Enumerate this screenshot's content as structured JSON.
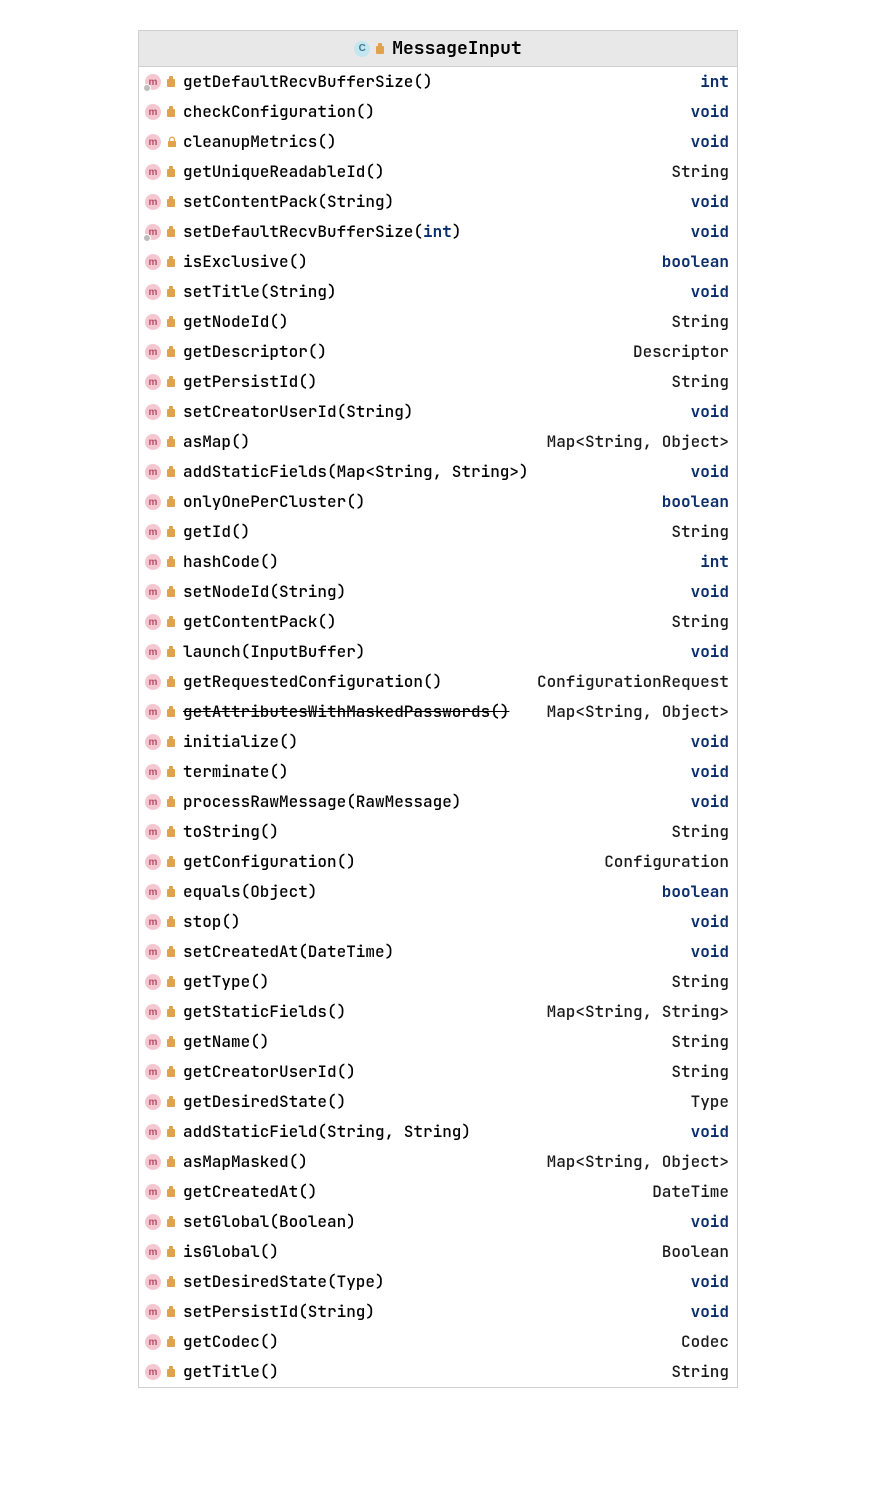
{
  "class": {
    "name": "MessageInput"
  },
  "methods": [
    {
      "abstract": true,
      "access": "public",
      "sig_parts": [
        {
          "t": "getDefaultRecvBufferSize()",
          "k": false
        }
      ],
      "ret_parts": [
        {
          "t": "int",
          "k": true
        }
      ],
      "deprecated": false
    },
    {
      "abstract": false,
      "access": "public",
      "sig_parts": [
        {
          "t": "checkConfiguration()",
          "k": false
        }
      ],
      "ret_parts": [
        {
          "t": "void",
          "k": true
        }
      ],
      "deprecated": false
    },
    {
      "abstract": false,
      "access": "private",
      "sig_parts": [
        {
          "t": "cleanupMetrics()",
          "k": false
        }
      ],
      "ret_parts": [
        {
          "t": "void",
          "k": true
        }
      ],
      "deprecated": false
    },
    {
      "abstract": false,
      "access": "public",
      "sig_parts": [
        {
          "t": "getUniqueReadableId()",
          "k": false
        }
      ],
      "ret_parts": [
        {
          "t": "String",
          "k": false
        }
      ],
      "deprecated": false
    },
    {
      "abstract": false,
      "access": "public",
      "sig_parts": [
        {
          "t": "setContentPack(String)",
          "k": false
        }
      ],
      "ret_parts": [
        {
          "t": "void",
          "k": true
        }
      ],
      "deprecated": false
    },
    {
      "abstract": true,
      "access": "public",
      "sig_parts": [
        {
          "t": "setDefaultRecvBufferSize(",
          "k": false
        },
        {
          "t": "int",
          "k": true
        },
        {
          "t": ")",
          "k": false
        }
      ],
      "ret_parts": [
        {
          "t": "void",
          "k": true
        }
      ],
      "deprecated": false
    },
    {
      "abstract": false,
      "access": "public",
      "sig_parts": [
        {
          "t": "isExclusive()",
          "k": false
        }
      ],
      "ret_parts": [
        {
          "t": "boolean",
          "k": true
        }
      ],
      "deprecated": false
    },
    {
      "abstract": false,
      "access": "public",
      "sig_parts": [
        {
          "t": "setTitle(String)",
          "k": false
        }
      ],
      "ret_parts": [
        {
          "t": "void",
          "k": true
        }
      ],
      "deprecated": false
    },
    {
      "abstract": false,
      "access": "public",
      "sig_parts": [
        {
          "t": "getNodeId()",
          "k": false
        }
      ],
      "ret_parts": [
        {
          "t": "String",
          "k": false
        }
      ],
      "deprecated": false
    },
    {
      "abstract": false,
      "access": "public",
      "sig_parts": [
        {
          "t": "getDescriptor()",
          "k": false
        }
      ],
      "ret_parts": [
        {
          "t": "Descriptor",
          "k": false
        }
      ],
      "deprecated": false
    },
    {
      "abstract": false,
      "access": "public",
      "sig_parts": [
        {
          "t": "getPersistId()",
          "k": false
        }
      ],
      "ret_parts": [
        {
          "t": "String",
          "k": false
        }
      ],
      "deprecated": false
    },
    {
      "abstract": false,
      "access": "public",
      "sig_parts": [
        {
          "t": "setCreatorUserId(String)",
          "k": false
        }
      ],
      "ret_parts": [
        {
          "t": "void",
          "k": true
        }
      ],
      "deprecated": false
    },
    {
      "abstract": false,
      "access": "public",
      "sig_parts": [
        {
          "t": "asMap()",
          "k": false
        }
      ],
      "ret_parts": [
        {
          "t": "Map<String, Object>",
          "k": false
        }
      ],
      "deprecated": false
    },
    {
      "abstract": false,
      "access": "public",
      "sig_parts": [
        {
          "t": "addStaticFields(Map<String, String>)",
          "k": false
        }
      ],
      "ret_parts": [
        {
          "t": "void",
          "k": true
        }
      ],
      "deprecated": false
    },
    {
      "abstract": false,
      "access": "public",
      "sig_parts": [
        {
          "t": "onlyOnePerCluster()",
          "k": false
        }
      ],
      "ret_parts": [
        {
          "t": "boolean",
          "k": true
        }
      ],
      "deprecated": false
    },
    {
      "abstract": false,
      "access": "public",
      "sig_parts": [
        {
          "t": "getId()",
          "k": false
        }
      ],
      "ret_parts": [
        {
          "t": "String",
          "k": false
        }
      ],
      "deprecated": false
    },
    {
      "abstract": false,
      "access": "public",
      "sig_parts": [
        {
          "t": "hashCode()",
          "k": false
        }
      ],
      "ret_parts": [
        {
          "t": "int",
          "k": true
        }
      ],
      "deprecated": false
    },
    {
      "abstract": false,
      "access": "public",
      "sig_parts": [
        {
          "t": "setNodeId(String)",
          "k": false
        }
      ],
      "ret_parts": [
        {
          "t": "void",
          "k": true
        }
      ],
      "deprecated": false
    },
    {
      "abstract": false,
      "access": "public",
      "sig_parts": [
        {
          "t": "getContentPack()",
          "k": false
        }
      ],
      "ret_parts": [
        {
          "t": "String",
          "k": false
        }
      ],
      "deprecated": false
    },
    {
      "abstract": false,
      "access": "public",
      "sig_parts": [
        {
          "t": "launch(InputBuffer)",
          "k": false
        }
      ],
      "ret_parts": [
        {
          "t": "void",
          "k": true
        }
      ],
      "deprecated": false
    },
    {
      "abstract": false,
      "access": "public",
      "sig_parts": [
        {
          "t": "getRequestedConfiguration()",
          "k": false
        }
      ],
      "ret_parts": [
        {
          "t": "ConfigurationRequest",
          "k": false
        }
      ],
      "deprecated": false
    },
    {
      "abstract": false,
      "access": "public",
      "sig_parts": [
        {
          "t": "getAttributesWithMaskedPasswords()",
          "k": false
        }
      ],
      "ret_parts": [
        {
          "t": "Map<String, Object>",
          "k": false
        }
      ],
      "deprecated": true
    },
    {
      "abstract": false,
      "access": "public",
      "sig_parts": [
        {
          "t": "initialize()",
          "k": false
        }
      ],
      "ret_parts": [
        {
          "t": "void",
          "k": true
        }
      ],
      "deprecated": false
    },
    {
      "abstract": false,
      "access": "public",
      "sig_parts": [
        {
          "t": "terminate()",
          "k": false
        }
      ],
      "ret_parts": [
        {
          "t": "void",
          "k": true
        }
      ],
      "deprecated": false
    },
    {
      "abstract": false,
      "access": "public",
      "sig_parts": [
        {
          "t": "processRawMessage(RawMessage)",
          "k": false
        }
      ],
      "ret_parts": [
        {
          "t": "void",
          "k": true
        }
      ],
      "deprecated": false
    },
    {
      "abstract": false,
      "access": "public",
      "sig_parts": [
        {
          "t": "toString()",
          "k": false
        }
      ],
      "ret_parts": [
        {
          "t": "String",
          "k": false
        }
      ],
      "deprecated": false
    },
    {
      "abstract": false,
      "access": "public",
      "sig_parts": [
        {
          "t": "getConfiguration()",
          "k": false
        }
      ],
      "ret_parts": [
        {
          "t": "Configuration",
          "k": false
        }
      ],
      "deprecated": false
    },
    {
      "abstract": false,
      "access": "public",
      "sig_parts": [
        {
          "t": "equals(Object)",
          "k": false
        }
      ],
      "ret_parts": [
        {
          "t": "boolean",
          "k": true
        }
      ],
      "deprecated": false
    },
    {
      "abstract": false,
      "access": "public",
      "sig_parts": [
        {
          "t": "stop()",
          "k": false
        }
      ],
      "ret_parts": [
        {
          "t": "void",
          "k": true
        }
      ],
      "deprecated": false
    },
    {
      "abstract": false,
      "access": "public",
      "sig_parts": [
        {
          "t": "setCreatedAt(DateTime)",
          "k": false
        }
      ],
      "ret_parts": [
        {
          "t": "void",
          "k": true
        }
      ],
      "deprecated": false
    },
    {
      "abstract": false,
      "access": "public",
      "sig_parts": [
        {
          "t": "getType()",
          "k": false
        }
      ],
      "ret_parts": [
        {
          "t": "String",
          "k": false
        }
      ],
      "deprecated": false
    },
    {
      "abstract": false,
      "access": "public",
      "sig_parts": [
        {
          "t": "getStaticFields()",
          "k": false
        }
      ],
      "ret_parts": [
        {
          "t": "Map<String, String>",
          "k": false
        }
      ],
      "deprecated": false
    },
    {
      "abstract": false,
      "access": "public",
      "sig_parts": [
        {
          "t": "getName()",
          "k": false
        }
      ],
      "ret_parts": [
        {
          "t": "String",
          "k": false
        }
      ],
      "deprecated": false
    },
    {
      "abstract": false,
      "access": "public",
      "sig_parts": [
        {
          "t": "getCreatorUserId()",
          "k": false
        }
      ],
      "ret_parts": [
        {
          "t": "String",
          "k": false
        }
      ],
      "deprecated": false
    },
    {
      "abstract": false,
      "access": "public",
      "sig_parts": [
        {
          "t": "getDesiredState()",
          "k": false
        }
      ],
      "ret_parts": [
        {
          "t": "Type",
          "k": false
        }
      ],
      "deprecated": false
    },
    {
      "abstract": false,
      "access": "public",
      "sig_parts": [
        {
          "t": "addStaticField(String, String)",
          "k": false
        }
      ],
      "ret_parts": [
        {
          "t": "void",
          "k": true
        }
      ],
      "deprecated": false
    },
    {
      "abstract": false,
      "access": "public",
      "sig_parts": [
        {
          "t": "asMapMasked()",
          "k": false
        }
      ],
      "ret_parts": [
        {
          "t": "Map<String, Object>",
          "k": false
        }
      ],
      "deprecated": false
    },
    {
      "abstract": false,
      "access": "public",
      "sig_parts": [
        {
          "t": "getCreatedAt()",
          "k": false
        }
      ],
      "ret_parts": [
        {
          "t": "DateTime",
          "k": false
        }
      ],
      "deprecated": false
    },
    {
      "abstract": false,
      "access": "public",
      "sig_parts": [
        {
          "t": "setGlobal(Boolean)",
          "k": false
        }
      ],
      "ret_parts": [
        {
          "t": "void",
          "k": true
        }
      ],
      "deprecated": false
    },
    {
      "abstract": false,
      "access": "public",
      "sig_parts": [
        {
          "t": "isGlobal()",
          "k": false
        }
      ],
      "ret_parts": [
        {
          "t": "Boolean",
          "k": false
        }
      ],
      "deprecated": false
    },
    {
      "abstract": false,
      "access": "public",
      "sig_parts": [
        {
          "t": "setDesiredState(Type)",
          "k": false
        }
      ],
      "ret_parts": [
        {
          "t": "void",
          "k": true
        }
      ],
      "deprecated": false
    },
    {
      "abstract": false,
      "access": "public",
      "sig_parts": [
        {
          "t": "setPersistId(String)",
          "k": false
        }
      ],
      "ret_parts": [
        {
          "t": "void",
          "k": true
        }
      ],
      "deprecated": false
    },
    {
      "abstract": false,
      "access": "public",
      "sig_parts": [
        {
          "t": "getCodec()",
          "k": false
        }
      ],
      "ret_parts": [
        {
          "t": "Codec",
          "k": false
        }
      ],
      "deprecated": false
    },
    {
      "abstract": false,
      "access": "public",
      "sig_parts": [
        {
          "t": "getTitle()",
          "k": false
        }
      ],
      "ret_parts": [
        {
          "t": "String",
          "k": false
        }
      ],
      "deprecated": false
    }
  ]
}
